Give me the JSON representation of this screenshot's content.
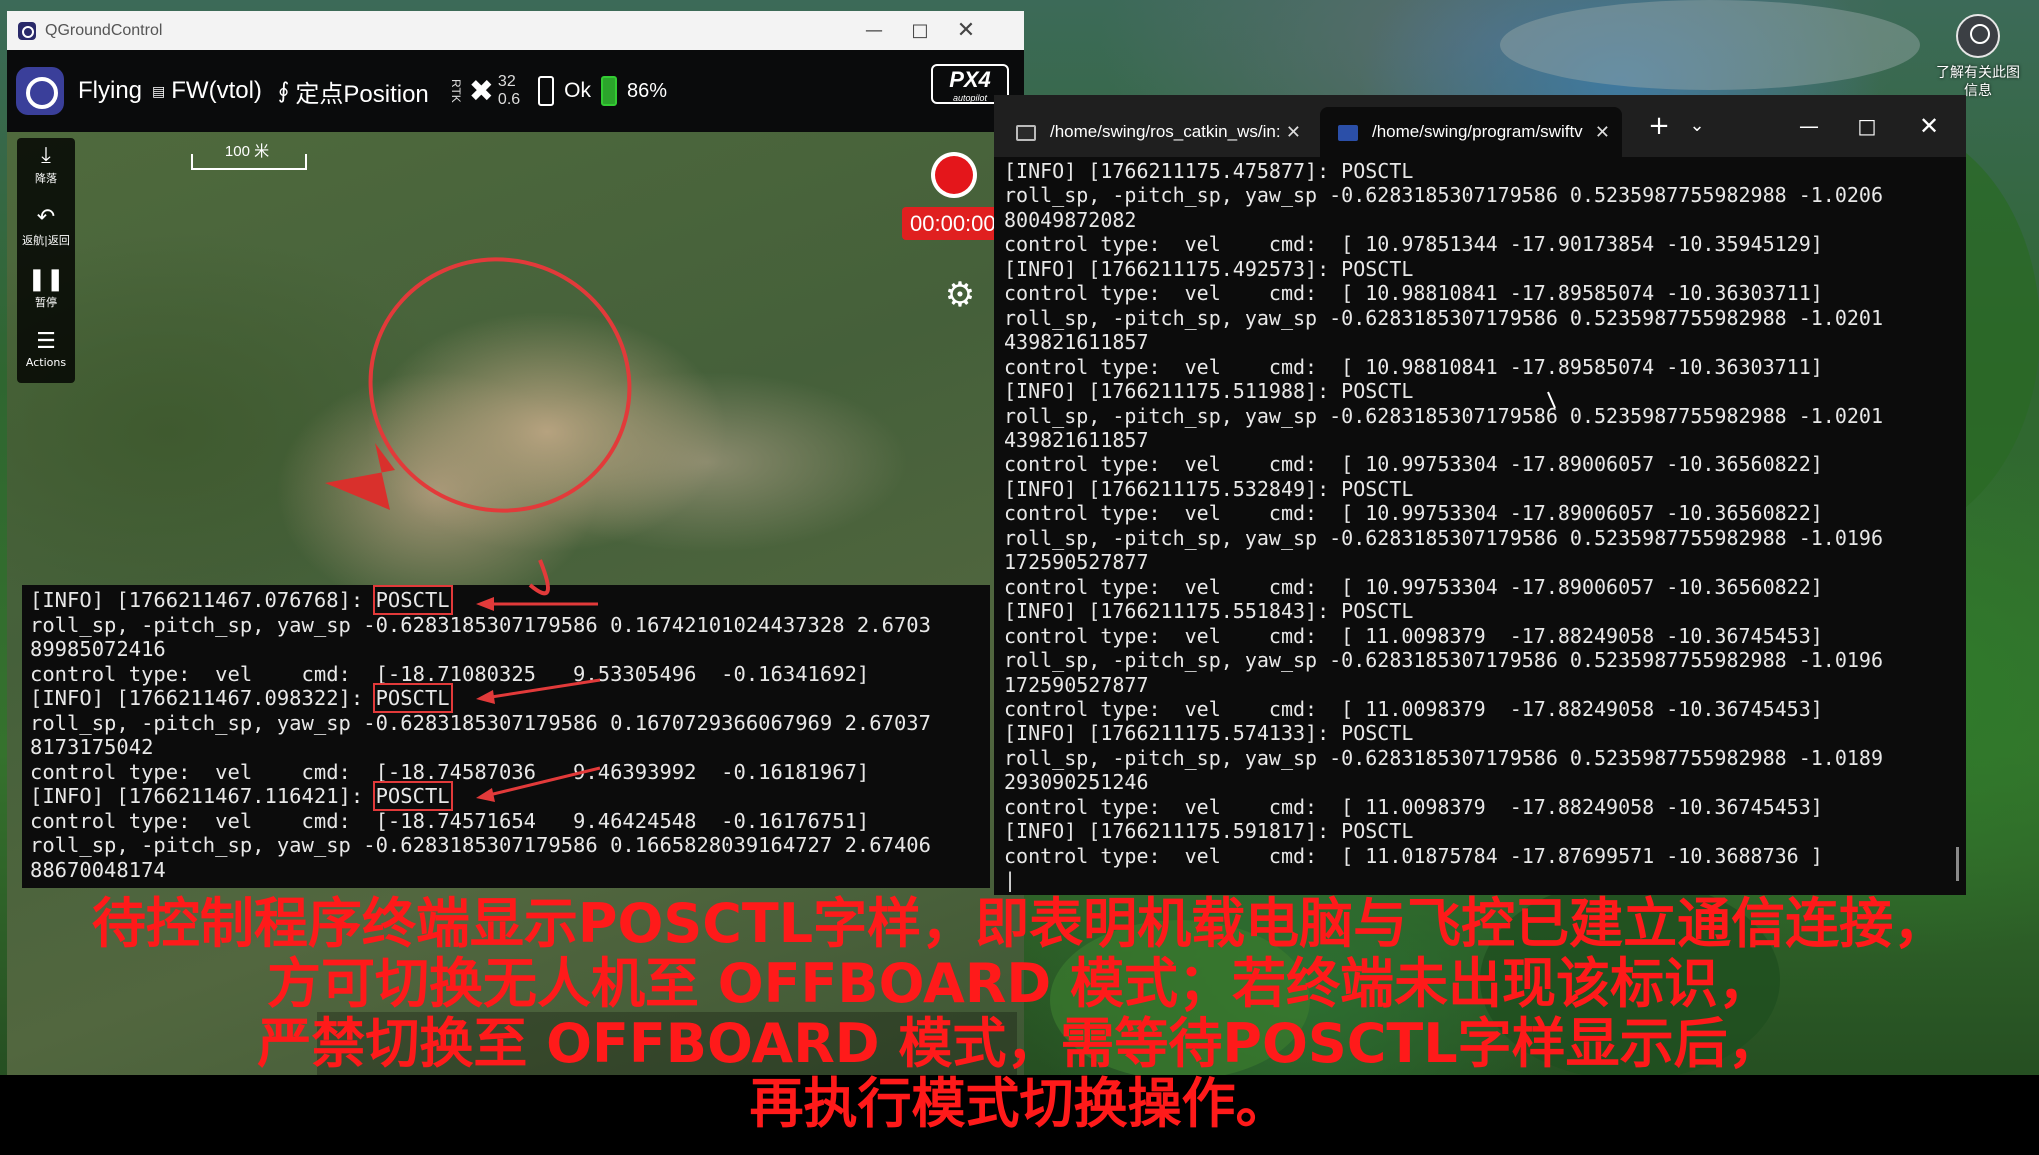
{
  "desktop": {
    "icon_label": "了解有关此图\n信息"
  },
  "qgc": {
    "window_title": "QGroundControl",
    "toolbar": {
      "flight_state": "Flying",
      "vehicle_type": "FW(vtol)",
      "flight_mode": "定点Position",
      "rtk_label": "RTK",
      "gps_count": "32",
      "hdop": "0.6",
      "battery_status": "Ok",
      "battery_percent": "86%",
      "autopilot_logo": "PX4",
      "autopilot_logo_sub": "autopilot"
    },
    "tools": [
      {
        "icon": "land-icon",
        "label": "降落"
      },
      {
        "icon": "return-icon",
        "label": "返航|返回"
      },
      {
        "icon": "pause-icon",
        "label": "暂停"
      },
      {
        "icon": "menu-icon",
        "label": "Actions"
      }
    ],
    "scale_label": "100 米",
    "record_timer": "00:00:00",
    "colors": {
      "record": "#e4161b",
      "annotation": "#e23a3a"
    }
  },
  "overlay_terminal": {
    "lines": [
      {
        "pre": "[INFO] [1766211467.076768]: ",
        "mode": "POSCTL"
      },
      {
        "text": "roll_sp, -pitch_sp, yaw_sp -0.6283185307179586 0.16742101024437328 2.6703"
      },
      {
        "text": "89985072416"
      },
      {
        "text": "control type:  vel    cmd:  [-18.71080325   9.53305496  -0.16341692]"
      },
      {
        "pre": "[INFO] [1766211467.098322]: ",
        "mode": "POSCTL"
      },
      {
        "text": "roll_sp, -pitch_sp, yaw_sp -0.6283185307179586 0.1670729366067969 2.67037"
      },
      {
        "text": "8173175042"
      },
      {
        "text": "control type:  vel    cmd:  [-18.74587036   9.46393992  -0.16181967]"
      },
      {
        "pre": "[INFO] [1766211467.116421]: ",
        "mode": "POSCTL"
      },
      {
        "text": "control type:  vel    cmd:  [-18.74571654   9.46424548  -0.16176751]"
      },
      {
        "text": "roll_sp, -pitch_sp, yaw_sp -0.6283185307179586 0.1665828039164727 2.67406"
      },
      {
        "text": "88670048174"
      }
    ]
  },
  "terminal": {
    "tab1_title": "/home/swing/ros_catkin_ws/in:",
    "tab2_title": "/home/swing/program/swiftv",
    "new_tab": "+",
    "dropdown": "⌄",
    "lines": [
      "[INFO] [1766211175.475877]: POSCTL",
      "roll_sp, -pitch_sp, yaw_sp -0.6283185307179586 0.5235987755982988 -1.0206",
      "80049872082",
      "control type:  vel    cmd:  [ 10.97851344 -17.90173854 -10.35945129]",
      "[INFO] [1766211175.492573]: POSCTL",
      "control type:  vel    cmd:  [ 10.98810841 -17.89585074 -10.36303711]",
      "roll_sp, -pitch_sp, yaw_sp -0.6283185307179586 0.5235987755982988 -1.0201",
      "439821611857",
      "control type:  vel    cmd:  [ 10.98810841 -17.89585074 -10.36303711]",
      "[INFO] [1766211175.511988]: POSCTL",
      "roll_sp, -pitch_sp, yaw_sp -0.6283185307179586 0.5235987755982988 -1.0201",
      "439821611857",
      "control type:  vel    cmd:  [ 10.99753304 -17.89006057 -10.36560822]",
      "[INFO] [1766211175.532849]: POSCTL",
      "control type:  vel    cmd:  [ 10.99753304 -17.89006057 -10.36560822]",
      "roll_sp, -pitch_sp, yaw_sp -0.6283185307179586 0.5235987755982988 -1.0196",
      "172590527877",
      "control type:  vel    cmd:  [ 10.99753304 -17.89006057 -10.36560822]",
      "[INFO] [1766211175.551843]: POSCTL",
      "control type:  vel    cmd:  [ 11.0098379  -17.88249058 -10.36745453]",
      "roll_sp, -pitch_sp, yaw_sp -0.6283185307179586 0.5235987755982988 -1.0196",
      "172590527877",
      "control type:  vel    cmd:  [ 11.0098379  -17.88249058 -10.36745453]",
      "[INFO] [1766211175.574133]: POSCTL",
      "roll_sp, -pitch_sp, yaw_sp -0.6283185307179586 0.5235987755982988 -1.0189",
      "293090251246",
      "control type:  vel    cmd:  [ 11.0098379  -17.88249058 -10.36745453]",
      "[INFO] [1766211175.591817]: POSCTL",
      "control type:  vel    cmd:  [ 11.01875784 -17.87699571 -10.3688736 ]",
      "|"
    ]
  },
  "subtitle": {
    "line1": "待控制程序终端显示POSCTL字样，即表明机载电脑与飞控已建立通信连接，",
    "line2": "方可切换无人机至 OFFBOARD 模式；若终端未出现该标识，",
    "line3": "严禁切换至 OFFBOARD 模式，需等待POSCTL字样显示后，",
    "line4": "再执行模式切换操作。",
    "color": "#ff1a1a"
  }
}
